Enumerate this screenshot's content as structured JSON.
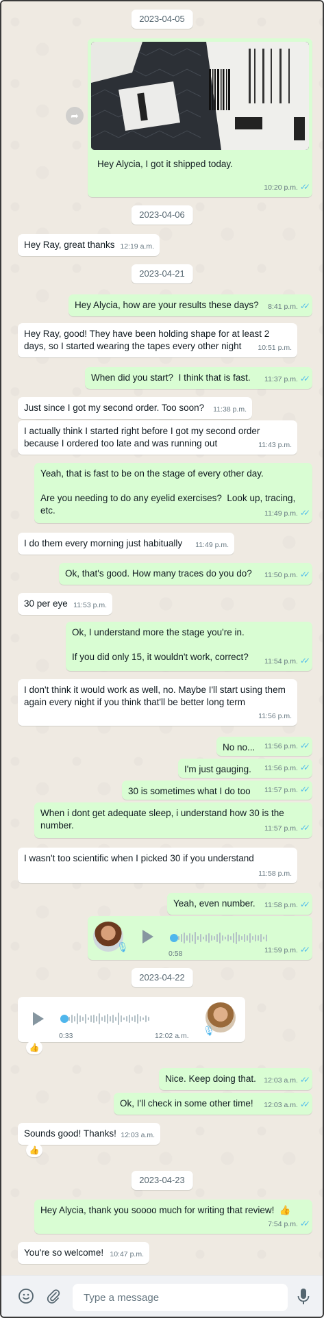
{
  "dates": {
    "d1": "2023-04-05",
    "d2": "2023-04-06",
    "d3": "2023-04-21",
    "d4": "2023-04-22",
    "d5": "2023-04-23"
  },
  "messages": {
    "m1": {
      "text": "Hey Alycia, I got it shipped today.",
      "time": "10:20 p.m."
    },
    "m2": {
      "text": "Hey Ray, great thanks",
      "time": "12:19 a.m."
    },
    "m3": {
      "text": "Hey Alycia, how are your results these days?",
      "time": "8:41 p.m."
    },
    "m4": {
      "text": "Hey Ray, good! They have been holding shape for at least 2 days, so I started wearing the tapes every other night",
      "time": "10:51 p.m."
    },
    "m5": {
      "text": "When did you start?  I think that is fast.",
      "time": "11:37 p.m."
    },
    "m6": {
      "text": "Just since I got my second order. Too soon?",
      "time": "11:38 p.m."
    },
    "m7": {
      "text": "I actually think I started right before I got my second order because I ordered too late and was running out",
      "time": "11:43 p.m."
    },
    "m8": {
      "text": "Yeah, that is fast to be on the stage of every other day.\n\nAre you needing to do any eyelid exercises?  Look up, tracing, etc.",
      "time": "11:49 p.m."
    },
    "m9": {
      "text": "I do them every morning just habitually",
      "time": "11:49 p.m."
    },
    "m10": {
      "text": "Ok, that's good. How many traces do you do?",
      "time": "11:50 p.m."
    },
    "m11": {
      "text": "30 per eye",
      "time": "11:53 p.m."
    },
    "m12": {
      "text": "Ok, I understand more the stage you're in.\n\nIf you did only 15, it wouldn't work, correct?",
      "time": "11:54 p.m."
    },
    "m13": {
      "text": "I don't think it would work as well, no. Maybe I'll start using them again every night if you think that'll be better long term",
      "time": "11:56 p.m."
    },
    "m14": {
      "text": "No no...",
      "time": "11:56 p.m."
    },
    "m15": {
      "text": "I'm just gauging.",
      "time": "11:56 p.m."
    },
    "m16": {
      "text": "30 is sometimes what I do too",
      "time": "11:57 p.m."
    },
    "m17": {
      "text": "When i dont get adequate sleep, i understand how 30 is the number.",
      "time": "11:57 p.m."
    },
    "m18": {
      "text": "I wasn't too scientific when I picked 30 if you understand",
      "time": "11:58 p.m."
    },
    "m19": {
      "text": "Yeah, even number.",
      "time": "11:58 p.m."
    },
    "m20": {
      "duration": "0:58",
      "time": "11:59 p.m.",
      "progress": 0.0
    },
    "m21": {
      "duration": "0:33",
      "time": "12:02 a.m.",
      "progress": 0.0,
      "reaction": "👍"
    },
    "m22": {
      "text": "Nice. Keep doing that.",
      "time": "12:03 a.m."
    },
    "m23": {
      "text": "Ok, I'll check in some other time!",
      "time": "12:03 a.m."
    },
    "m24": {
      "text": "Sounds good! Thanks!",
      "time": "12:03 a.m.",
      "reaction": "👍"
    },
    "m25": {
      "text": "Hey Alycia, thank you soooo much for writing that review!  👍",
      "time": "7:54 p.m."
    },
    "m26": {
      "text": "You're so welcome!",
      "time": "10:47 p.m."
    }
  },
  "composer": {
    "placeholder": "Type a message"
  },
  "colors": {
    "outgoing_bubble": "#d9fdd3",
    "incoming_bubble": "#ffffff",
    "chat_background": "#efeae2",
    "read_ticks": "#53bdeb"
  },
  "icons": {
    "emoji": "emoji-icon",
    "attach": "paperclip-icon",
    "mic": "microphone-icon",
    "forward": "forward-icon",
    "play": "play-icon",
    "ticks": "double-check-icon"
  }
}
